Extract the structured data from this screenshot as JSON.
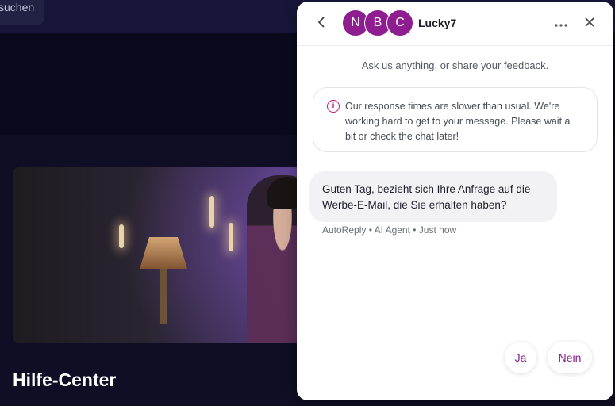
{
  "background": {
    "search_text": "suchen",
    "help_center_title": "Hilfe-Center"
  },
  "chat": {
    "header": {
      "back_icon": "chevron-left-icon",
      "avatars": [
        "N",
        "B",
        "C"
      ],
      "brand_name": "Lucky7",
      "more_icon": "more-horizontal-icon",
      "close_icon": "close-icon"
    },
    "intro_text": "Ask us anything, or share your feedback.",
    "notice": {
      "icon": "info-icon",
      "text": "Our response times are slower than usual. We're working hard to get to your message. Please wait a bit or check the chat later!"
    },
    "message": {
      "text": "Guten Tag, bezieht sich Ihre Anfrage auf die Werbe-E-Mail, die Sie erhalten haben?",
      "meta": "AutoReply • AI Agent • Just now"
    },
    "quick_replies": [
      "Ja",
      "Nein"
    ]
  },
  "colors": {
    "accent": "#8e1d8f",
    "page_background": "#0f0e25",
    "notice_icon": "#c2187f"
  }
}
